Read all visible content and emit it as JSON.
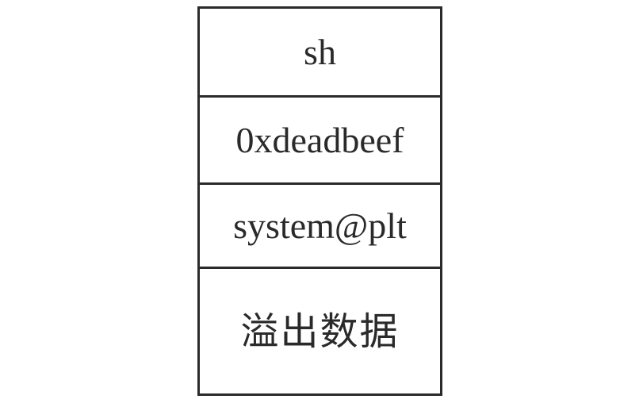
{
  "stack": {
    "cells": [
      {
        "label": "sh"
      },
      {
        "label": "0xdeadbeef"
      },
      {
        "label": "system@plt"
      },
      {
        "label": "溢出数据"
      }
    ]
  }
}
